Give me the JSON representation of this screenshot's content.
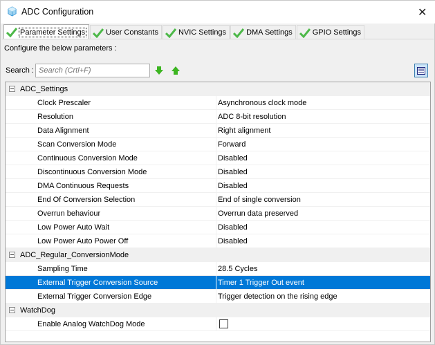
{
  "window": {
    "title": "ADC Configuration",
    "close": "✕"
  },
  "tabs": [
    {
      "label": "Parameter Settings"
    },
    {
      "label": "User Constants"
    },
    {
      "label": "NVIC Settings"
    },
    {
      "label": "DMA Settings"
    },
    {
      "label": "GPIO Settings"
    }
  ],
  "configure_label": "Configure the below parameters :",
  "search": {
    "label": "Search :",
    "placeholder": "Search (Crtl+F)"
  },
  "groups": [
    {
      "name": "ADC_Settings",
      "params": [
        {
          "name": "Clock Prescaler",
          "value": "Asynchronous clock mode"
        },
        {
          "name": "Resolution",
          "value": "ADC 8-bit resolution"
        },
        {
          "name": "Data Alignment",
          "value": "Right alignment"
        },
        {
          "name": "Scan Conversion Mode",
          "value": "Forward"
        },
        {
          "name": "Continuous Conversion Mode",
          "value": "Disabled"
        },
        {
          "name": "Discontinuous Conversion Mode",
          "value": "Disabled"
        },
        {
          "name": "DMA Continuous Requests",
          "value": "Disabled"
        },
        {
          "name": "End Of Conversion Selection",
          "value": "End of single conversion"
        },
        {
          "name": "Overrun behaviour",
          "value": "Overrun data preserved"
        },
        {
          "name": "Low Power Auto Wait",
          "value": "Disabled"
        },
        {
          "name": "Low Power Auto Power Off",
          "value": "Disabled"
        }
      ]
    },
    {
      "name": "ADC_Regular_ConversionMode",
      "params": [
        {
          "name": "Sampling Time",
          "value": "28.5 Cycles"
        },
        {
          "name": "External Trigger Conversion Source",
          "value": "Timer 1 Trigger Out event"
        },
        {
          "name": "External Trigger Conversion Edge",
          "value": "Trigger detection on the rising edge"
        }
      ]
    },
    {
      "name": "WatchDog",
      "params": [
        {
          "name": "Enable Analog WatchDog Mode",
          "checked": false
        }
      ]
    }
  ]
}
